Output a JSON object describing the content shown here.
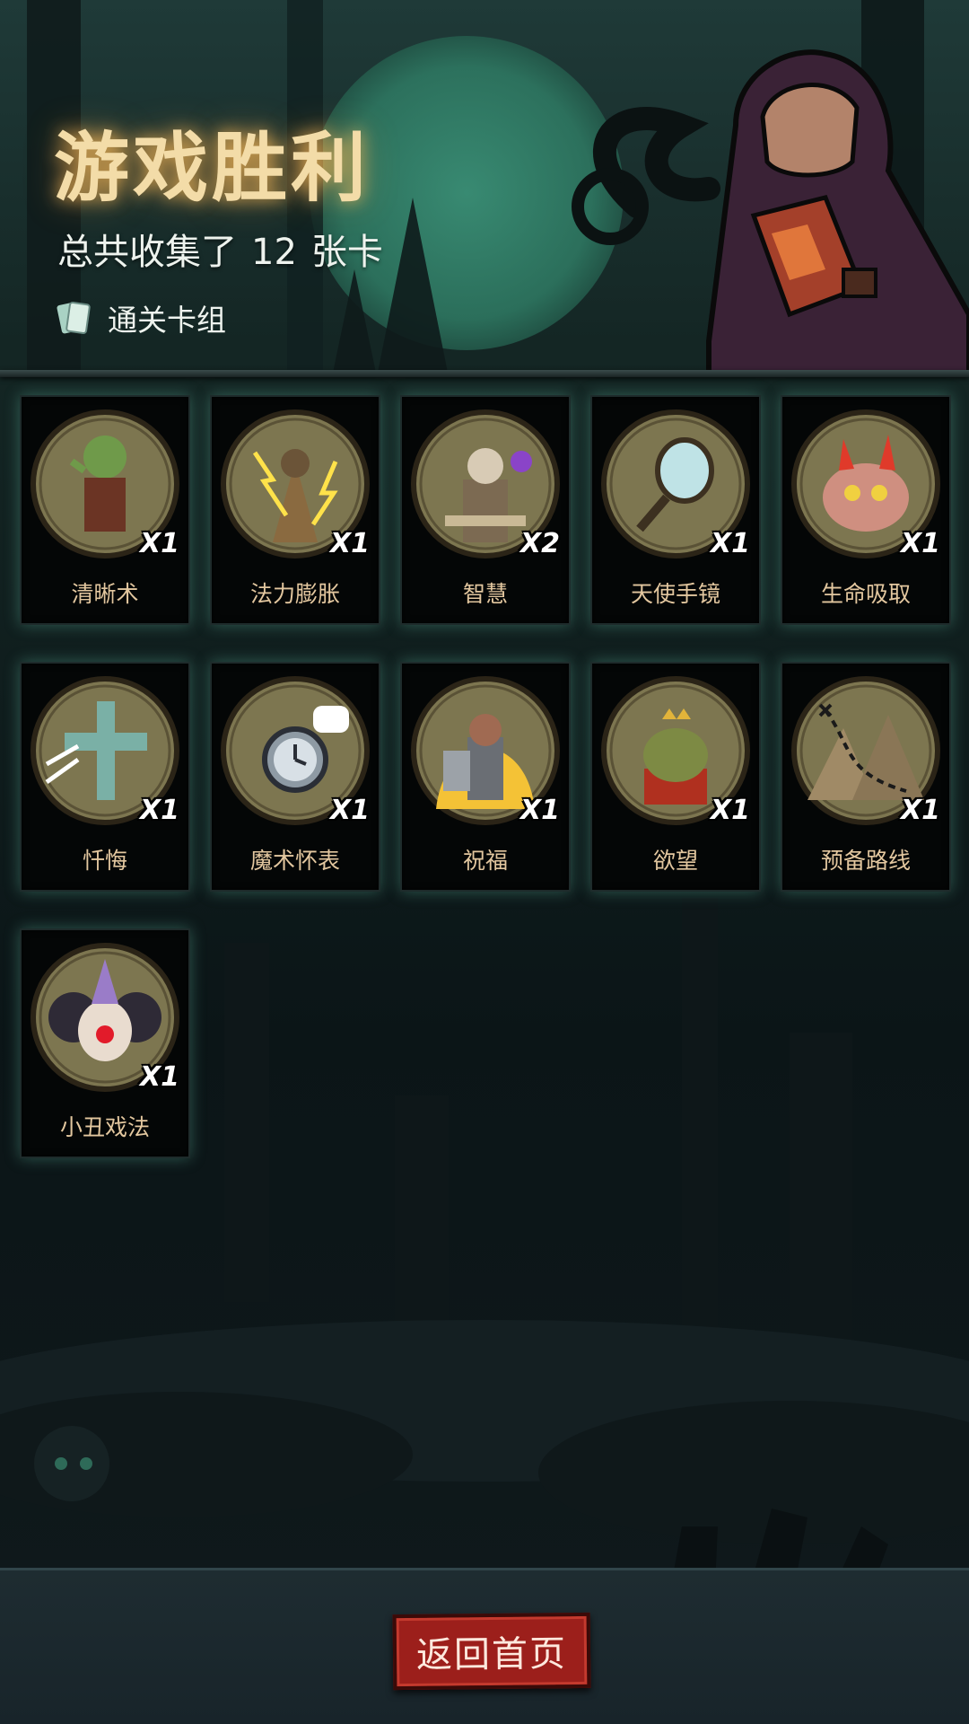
{
  "header": {
    "title": "游戏胜利",
    "summary_prefix": "总共收集了",
    "card_count": "12",
    "summary_suffix": "张卡",
    "deck_link_label": "通关卡组"
  },
  "cards": [
    {
      "name": "清晰术",
      "qty": "X1",
      "icon": "goblin-icon"
    },
    {
      "name": "法力膨胀",
      "qty": "X1",
      "icon": "lightning-mage-icon"
    },
    {
      "name": "智慧",
      "qty": "X2",
      "icon": "sage-icon"
    },
    {
      "name": "天使手镜",
      "qty": "X1",
      "icon": "hand-mirror-icon"
    },
    {
      "name": "生命吸取",
      "qty": "X1",
      "icon": "demon-icon"
    },
    {
      "name": "忏悔",
      "qty": "X1",
      "icon": "cross-icon"
    },
    {
      "name": "魔术怀表",
      "qty": "X1",
      "icon": "pocket-watch-icon"
    },
    {
      "name": "祝福",
      "qty": "X1",
      "icon": "knight-icon"
    },
    {
      "name": "欲望",
      "qty": "X1",
      "icon": "toad-king-icon"
    },
    {
      "name": "预备路线",
      "qty": "X1",
      "icon": "map-route-icon"
    },
    {
      "name": "小丑戏法",
      "qty": "X1",
      "icon": "clown-icon"
    }
  ],
  "footer": {
    "home_button_label": "返回首页"
  },
  "colors": {
    "title": "#f3dca8",
    "card_name": "#e3c79f",
    "card_glow": "#6ed2b4",
    "button": "#9c1f1b"
  }
}
